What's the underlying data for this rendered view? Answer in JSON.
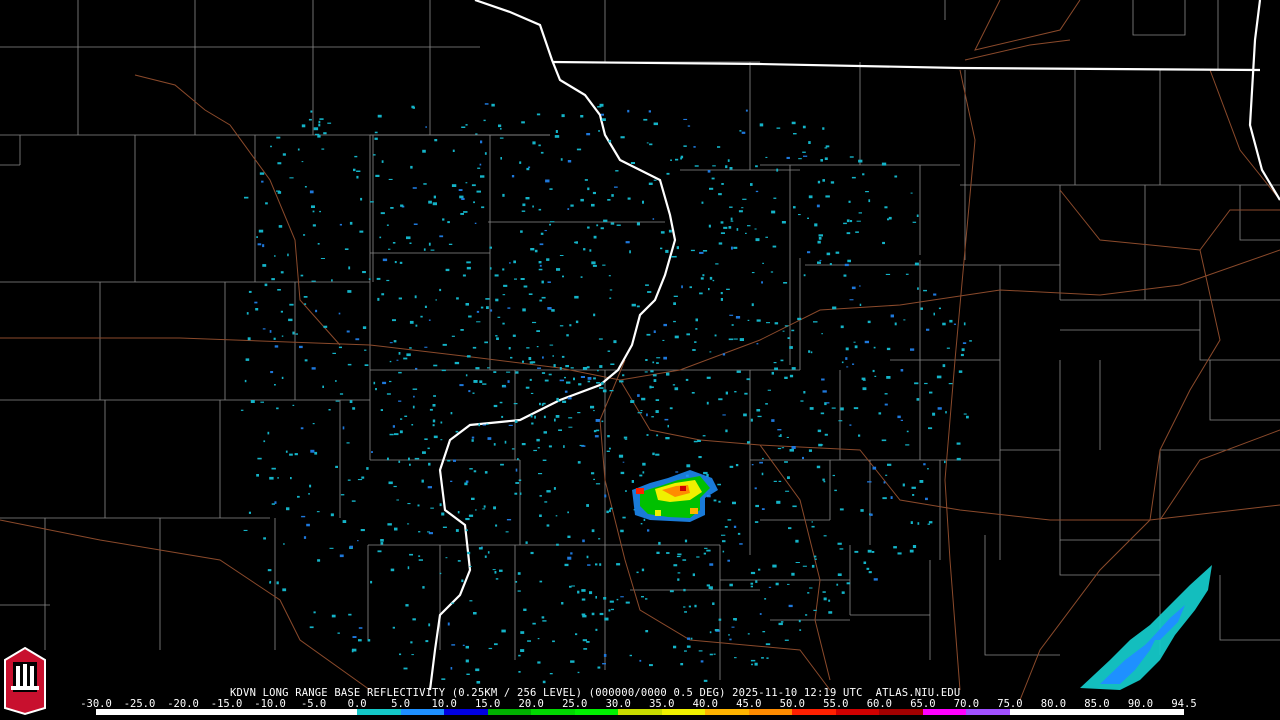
{
  "radar": {
    "caption": "KDVN LONG RANGE BASE REFLECTIVITY (0.25KM / 256 LEVEL) (000000/0000 0.5 DEG) 2025-11-10 12:19 UTC  ATLAS.NIU.EDU",
    "scale_labels": [
      "-30.0",
      "-25.0",
      "-20.0",
      "-15.0",
      "-10.0",
      "-5.0",
      "0.0",
      "5.0",
      "10.0",
      "15.0",
      "20.0",
      "25.0",
      "30.0",
      "35.0",
      "40.0",
      "45.0",
      "50.0",
      "55.0",
      "60.0",
      "65.0",
      "70.0",
      "75.0",
      "80.0",
      "85.0",
      "90.0",
      "94.5"
    ],
    "scale_colors": [
      "#ffffff",
      "#ffffff",
      "#ffffff",
      "#ffffff",
      "#ffffff",
      "#ffffff",
      "#14c8c8",
      "#1e90ff",
      "#0000e0",
      "#00b000",
      "#00d800",
      "#00f000",
      "#c8dc00",
      "#f0f000",
      "#ffb400",
      "#ff8c00",
      "#ff2000",
      "#d00000",
      "#a00000",
      "#ff00ff",
      "#a050ff",
      "#ffffff",
      "#ffffff",
      "#ffffff",
      "#ffffff"
    ],
    "logo_text": "NIU"
  },
  "colors": {
    "background": "#000000",
    "county_lines": "#8a8a8a",
    "state_lines": "#ffffff",
    "highways": "#8b4a2b"
  }
}
